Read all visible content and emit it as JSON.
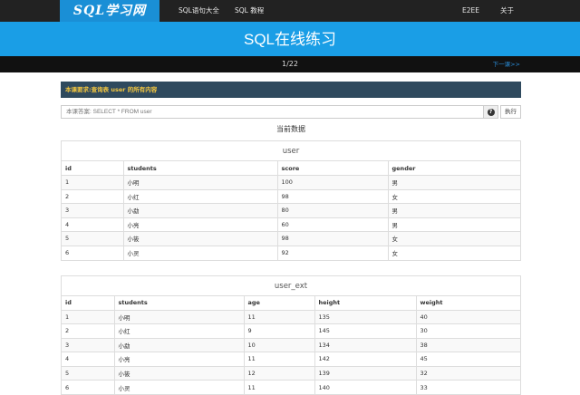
{
  "nav": {
    "logo": "SQL学习网",
    "links": [
      "SQL语句大全",
      "SQL 教程",
      "E2EE",
      "关于"
    ]
  },
  "banner": {
    "title": "SQL在线练习"
  },
  "pager": {
    "page": "1/22",
    "next": "下一课>>"
  },
  "lesson": {
    "text": "本课要求:查询表 user 的所有内容"
  },
  "query": {
    "placeholder": "本课答案: SELECT * FROM user",
    "help": "?",
    "run_label": "执行"
  },
  "current_data_label": "当前数据",
  "tables": [
    {
      "name": "user",
      "columns": [
        "id",
        "students",
        "score",
        "gender"
      ],
      "rows": [
        [
          "1",
          "小明",
          "100",
          "男"
        ],
        [
          "2",
          "小红",
          "98",
          "女"
        ],
        [
          "3",
          "小勐",
          "80",
          "男"
        ],
        [
          "4",
          "小亮",
          "60",
          "男"
        ],
        [
          "5",
          "小筱",
          "98",
          "女"
        ],
        [
          "6",
          "小灵",
          "92",
          "女"
        ]
      ]
    },
    {
      "name": "user_ext",
      "columns": [
        "id",
        "students",
        "age",
        "height",
        "weight"
      ],
      "rows": [
        [
          "1",
          "小明",
          "11",
          "135",
          "40"
        ],
        [
          "2",
          "小红",
          "9",
          "145",
          "30"
        ],
        [
          "3",
          "小勐",
          "10",
          "134",
          "38"
        ],
        [
          "4",
          "小亮",
          "11",
          "142",
          "45"
        ],
        [
          "5",
          "小筱",
          "12",
          "139",
          "32"
        ],
        [
          "6",
          "小灵",
          "11",
          "140",
          "33"
        ]
      ]
    }
  ]
}
